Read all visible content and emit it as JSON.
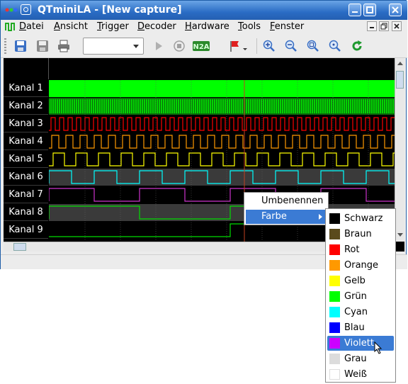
{
  "window": {
    "title": "QTminiLA - [New capture]"
  },
  "menubar": {
    "items": [
      {
        "label": "Datei",
        "mnemonic": "D",
        "rest": "atei"
      },
      {
        "label": "Ansicht",
        "mnemonic": "A",
        "rest": "nsicht"
      },
      {
        "label": "Trigger",
        "mnemonic": "T",
        "rest": "rigger"
      },
      {
        "label": "Decoder",
        "mnemonic": "D",
        "rest": "ecoder"
      },
      {
        "label": "Hardware",
        "mnemonic": "H",
        "rest": "ardware"
      },
      {
        "label": "Tools",
        "mnemonic": "T",
        "rest": "ools"
      },
      {
        "label": "Fenster",
        "mnemonic": "F",
        "rest": "enster"
      }
    ]
  },
  "toolbar": {
    "icons": [
      "save-icon",
      "save-as-icon",
      "print-icon",
      "play-icon",
      "stop-icon",
      "n2a-icon",
      "flag-icon",
      "zoom-in-icon",
      "zoom-out-icon",
      "zoom-fit-icon",
      "zoom-all-icon",
      "refresh-icon"
    ],
    "combo_value": ""
  },
  "channels": [
    {
      "label": "Kanal 1",
      "color": "#00ff00"
    },
    {
      "label": "Kanal 2",
      "color": "#00ff00"
    },
    {
      "label": "Kanal 3",
      "color": "#ff0000"
    },
    {
      "label": "Kanal 4",
      "color": "#ff9900"
    },
    {
      "label": "Kanal 5",
      "color": "#ffff00"
    },
    {
      "label": "Kanal 6",
      "color": "#00ffff"
    },
    {
      "label": "Kanal 7",
      "color": "#cc33cc"
    },
    {
      "label": "Kanal 8",
      "color": "#00dd00"
    },
    {
      "label": "Kanal 9",
      "color": "#00dd00"
    }
  ],
  "context_menu": {
    "items": [
      {
        "label": "Umbenennen"
      },
      {
        "label": "Farbe"
      }
    ]
  },
  "color_menu": {
    "items": [
      {
        "label": "Schwarz",
        "color": "#000000"
      },
      {
        "label": "Braun",
        "color": "#5a4a1c"
      },
      {
        "label": "Rot",
        "color": "#ff0000"
      },
      {
        "label": "Orange",
        "color": "#ff9900"
      },
      {
        "label": "Gelb",
        "color": "#ffff00"
      },
      {
        "label": "Grün",
        "color": "#00ff00"
      },
      {
        "label": "Cyan",
        "color": "#00ffff"
      },
      {
        "label": "Blau",
        "color": "#0000ff"
      },
      {
        "label": "Violett",
        "color": "#cc00ff"
      },
      {
        "label": "Grau",
        "color": "#dcdcdc"
      },
      {
        "label": "Weiß",
        "color": "#ffffff"
      }
    ],
    "highlighted": "Violett"
  },
  "colors": {
    "accent": "#3b7bd4",
    "titlebar": "#2a6cc4"
  }
}
